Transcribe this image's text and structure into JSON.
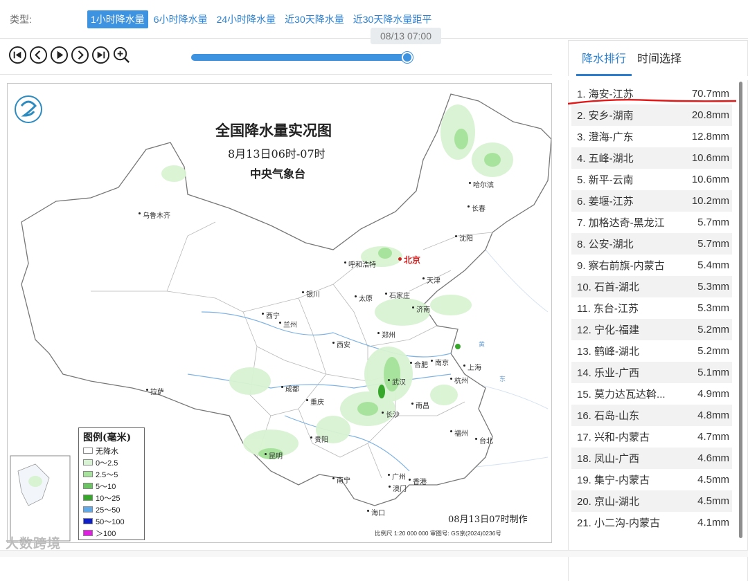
{
  "typebar": {
    "label": "类型:",
    "tabs": [
      "1小时降水量",
      "6小时降水量",
      "24小时降水量",
      "近30天降水量",
      "近30天降水量距平"
    ],
    "active_index": 0
  },
  "player": {
    "buttons": [
      "first-icon",
      "prev-icon",
      "play-icon",
      "next-icon",
      "last-icon",
      "zoom-in-icon"
    ],
    "progress": 1.0,
    "current_time": "08/13 07:00"
  },
  "map": {
    "title": "全国降水量实况图",
    "subtitle": "8月13日06时-07时",
    "org": "中央气象台",
    "made_time": "08月13日07时制作",
    "scale_text": "比例尺 1:20 000 000    审图号: GS京(2024)0236号",
    "cities": [
      {
        "name": "乌鲁木齐",
        "cap": false
      },
      {
        "name": "哈尔滨",
        "cap": false
      },
      {
        "name": "长春",
        "cap": false
      },
      {
        "name": "沈阳",
        "cap": false
      },
      {
        "name": "呼和浩特",
        "cap": false
      },
      {
        "name": "北京",
        "cap": true
      },
      {
        "name": "天津",
        "cap": false
      },
      {
        "name": "银川",
        "cap": false
      },
      {
        "name": "太原",
        "cap": false
      },
      {
        "name": "石家庄",
        "cap": false
      },
      {
        "name": "济南",
        "cap": false
      },
      {
        "name": "西宁",
        "cap": false
      },
      {
        "name": "兰州",
        "cap": false
      },
      {
        "name": "郑州",
        "cap": false
      },
      {
        "name": "西安",
        "cap": false
      },
      {
        "name": "合肥",
        "cap": false
      },
      {
        "name": "南京",
        "cap": false
      },
      {
        "name": "上海",
        "cap": false
      },
      {
        "name": "拉萨",
        "cap": false
      },
      {
        "name": "成都",
        "cap": false
      },
      {
        "name": "武汉",
        "cap": false
      },
      {
        "name": "杭州",
        "cap": false
      },
      {
        "name": "重庆",
        "cap": false
      },
      {
        "name": "南昌",
        "cap": false
      },
      {
        "name": "长沙",
        "cap": false
      },
      {
        "name": "福州",
        "cap": false
      },
      {
        "name": "贵阳",
        "cap": false
      },
      {
        "name": "台北",
        "cap": false
      },
      {
        "name": "昆明",
        "cap": false
      },
      {
        "name": "南宁",
        "cap": false
      },
      {
        "name": "广州",
        "cap": false
      },
      {
        "name": "澳门",
        "cap": false
      },
      {
        "name": "香港",
        "cap": false
      },
      {
        "name": "海口",
        "cap": false
      }
    ],
    "legend": {
      "title": "图例(毫米)",
      "items": [
        {
          "label": "无降水",
          "color": "#ffffff"
        },
        {
          "label": "0～2.5",
          "color": "#d8f3d2"
        },
        {
          "label": "2.5～5",
          "color": "#a8e39d"
        },
        {
          "label": "5～10",
          "color": "#69c461"
        },
        {
          "label": "10～25",
          "color": "#37a72c"
        },
        {
          "label": "25～50",
          "color": "#5fa9e8"
        },
        {
          "label": "50～100",
          "color": "#1020c8"
        },
        {
          "label": "＞100",
          "color": "#e020e0"
        }
      ]
    }
  },
  "watermark": "大数跨境",
  "ranking": {
    "tabs": [
      "降水排行",
      "时间选择"
    ],
    "active_index": 0,
    "items": [
      {
        "name": "1. 海安-江苏",
        "value": "70.7mm"
      },
      {
        "name": "2. 安乡-湖南",
        "value": "20.8mm"
      },
      {
        "name": "3. 澄海-广东",
        "value": "12.8mm"
      },
      {
        "name": "4. 五峰-湖北",
        "value": "10.6mm"
      },
      {
        "name": "5. 新平-云南",
        "value": "10.6mm"
      },
      {
        "name": "6. 姜堰-江苏",
        "value": "10.2mm"
      },
      {
        "name": "7. 加格达奇-黑龙江",
        "value": "5.7mm"
      },
      {
        "name": "8. 公安-湖北",
        "value": "5.7mm"
      },
      {
        "name": "9. 察右前旗-内蒙古",
        "value": "5.4mm"
      },
      {
        "name": "10. 石首-湖北",
        "value": "5.3mm"
      },
      {
        "name": "11. 东台-江苏",
        "value": "5.3mm"
      },
      {
        "name": "12. 宁化-福建",
        "value": "5.2mm"
      },
      {
        "name": "13. 鹤峰-湖北",
        "value": "5.2mm"
      },
      {
        "name": "14. 乐业-广西",
        "value": "5.1mm"
      },
      {
        "name": "15. 莫力达瓦达斡...",
        "value": "4.9mm"
      },
      {
        "name": "16. 石岛-山东",
        "value": "4.8mm"
      },
      {
        "name": "17. 兴和-内蒙古",
        "value": "4.7mm"
      },
      {
        "name": "18. 凤山-广西",
        "value": "4.6mm"
      },
      {
        "name": "19. 集宁-内蒙古",
        "value": "4.5mm"
      },
      {
        "name": "20. 京山-湖北",
        "value": "4.5mm"
      },
      {
        "name": "21. 小二沟-内蒙古",
        "value": "4.1mm"
      }
    ]
  }
}
